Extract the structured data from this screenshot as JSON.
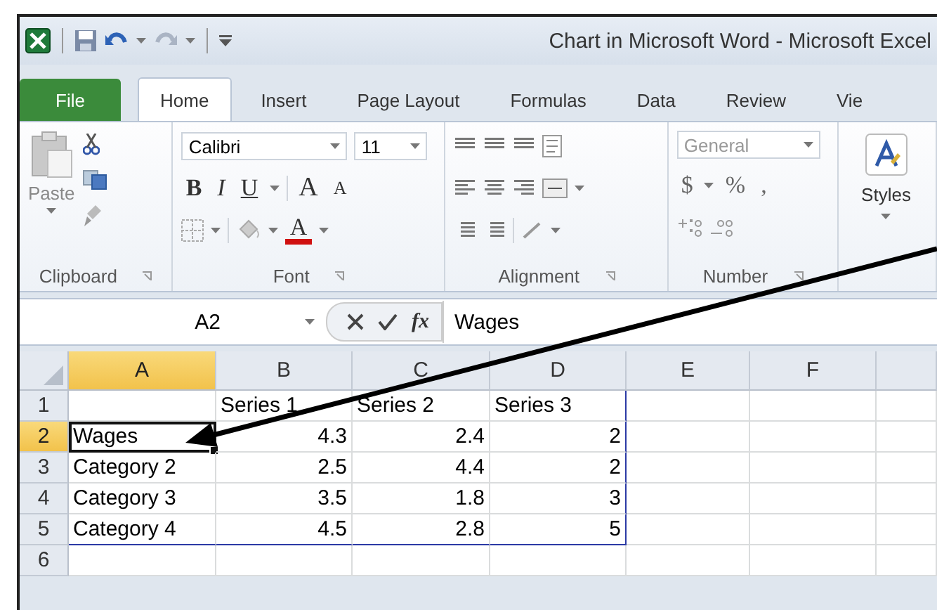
{
  "window": {
    "title": "Chart in Microsoft Word  -  Microsoft Excel"
  },
  "tabs": [
    {
      "label": "File",
      "kind": "file",
      "selected": false
    },
    {
      "label": "Home",
      "kind": "tab",
      "selected": true
    },
    {
      "label": "Insert",
      "kind": "tab",
      "selected": false
    },
    {
      "label": "Page Layout",
      "kind": "tab",
      "selected": false
    },
    {
      "label": "Formulas",
      "kind": "tab",
      "selected": false
    },
    {
      "label": "Data",
      "kind": "tab",
      "selected": false
    },
    {
      "label": "Review",
      "kind": "tab",
      "selected": false
    },
    {
      "label": "Vie",
      "kind": "tab",
      "selected": false
    }
  ],
  "ribbon": {
    "clipboard": {
      "paste_label": "Paste",
      "group_label": "Clipboard"
    },
    "font": {
      "font_name": "Calibri",
      "font_size": "11",
      "bold": "B",
      "italic": "I",
      "underline": "U",
      "grow": "A",
      "shrink": "A",
      "font_color": "A",
      "group_label": "Font"
    },
    "alignment": {
      "group_label": "Alignment"
    },
    "number": {
      "format": "General",
      "currency": "$",
      "percent": "%",
      "comma": ",",
      "group_label": "Number"
    },
    "styles": {
      "label": "Styles"
    }
  },
  "formula_bar": {
    "name_box": "A2",
    "function_label": "fx",
    "value": "Wages"
  },
  "sheet": {
    "columns": [
      {
        "label": "A",
        "selected": true
      },
      {
        "label": "B",
        "selected": false
      },
      {
        "label": "C",
        "selected": false
      },
      {
        "label": "D",
        "selected": false
      },
      {
        "label": "E",
        "selected": false
      },
      {
        "label": "F",
        "selected": false
      }
    ],
    "rows": [
      {
        "label": "1",
        "selected": false,
        "cells": [
          {
            "kind": "empty",
            "range_right": false,
            "range_bottom": false,
            "active": false
          },
          {
            "kind": "label",
            "text": "Series 1",
            "range_right": false,
            "range_bottom": false,
            "active": false
          },
          {
            "kind": "label",
            "text": "Series 2",
            "range_right": false,
            "range_bottom": false,
            "active": false
          },
          {
            "kind": "label",
            "text": "Series 3",
            "range_right": true,
            "range_bottom": false,
            "active": false
          }
        ]
      },
      {
        "label": "2",
        "selected": true,
        "cells": [
          {
            "kind": "label",
            "text": "Wages",
            "range_right": false,
            "range_bottom": false,
            "active": true
          },
          {
            "kind": "number",
            "text": "4.3",
            "range_right": false,
            "range_bottom": false,
            "active": false
          },
          {
            "kind": "number",
            "text": "2.4",
            "range_right": false,
            "range_bottom": false,
            "active": false
          },
          {
            "kind": "number",
            "text": "2",
            "range_right": true,
            "range_bottom": false,
            "active": false
          }
        ]
      },
      {
        "label": "3",
        "selected": false,
        "cells": [
          {
            "kind": "label",
            "text": "Category 2",
            "range_right": false,
            "range_bottom": false,
            "active": false
          },
          {
            "kind": "number",
            "text": "2.5",
            "range_right": false,
            "range_bottom": false,
            "active": false
          },
          {
            "kind": "number",
            "text": "4.4",
            "range_right": false,
            "range_bottom": false,
            "active": false
          },
          {
            "kind": "number",
            "text": "2",
            "range_right": true,
            "range_bottom": false,
            "active": false
          }
        ]
      },
      {
        "label": "4",
        "selected": false,
        "cells": [
          {
            "kind": "label",
            "text": "Category 3",
            "range_right": false,
            "range_bottom": false,
            "active": false
          },
          {
            "kind": "number",
            "text": "3.5",
            "range_right": false,
            "range_bottom": false,
            "active": false
          },
          {
            "kind": "number",
            "text": "1.8",
            "range_right": false,
            "range_bottom": false,
            "active": false
          },
          {
            "kind": "number",
            "text": "3",
            "range_right": true,
            "range_bottom": false,
            "active": false
          }
        ]
      },
      {
        "label": "5",
        "selected": false,
        "cells": [
          {
            "kind": "label",
            "text": "Category 4",
            "range_right": false,
            "range_bottom": true,
            "active": false
          },
          {
            "kind": "number",
            "text": "4.5",
            "range_right": false,
            "range_bottom": true,
            "active": false
          },
          {
            "kind": "number",
            "text": "2.8",
            "range_right": false,
            "range_bottom": true,
            "active": false
          },
          {
            "kind": "number",
            "text": "5",
            "range_right": true,
            "range_bottom": true,
            "active": false
          }
        ]
      },
      {
        "label": "6",
        "selected": false,
        "cells": []
      }
    ]
  }
}
